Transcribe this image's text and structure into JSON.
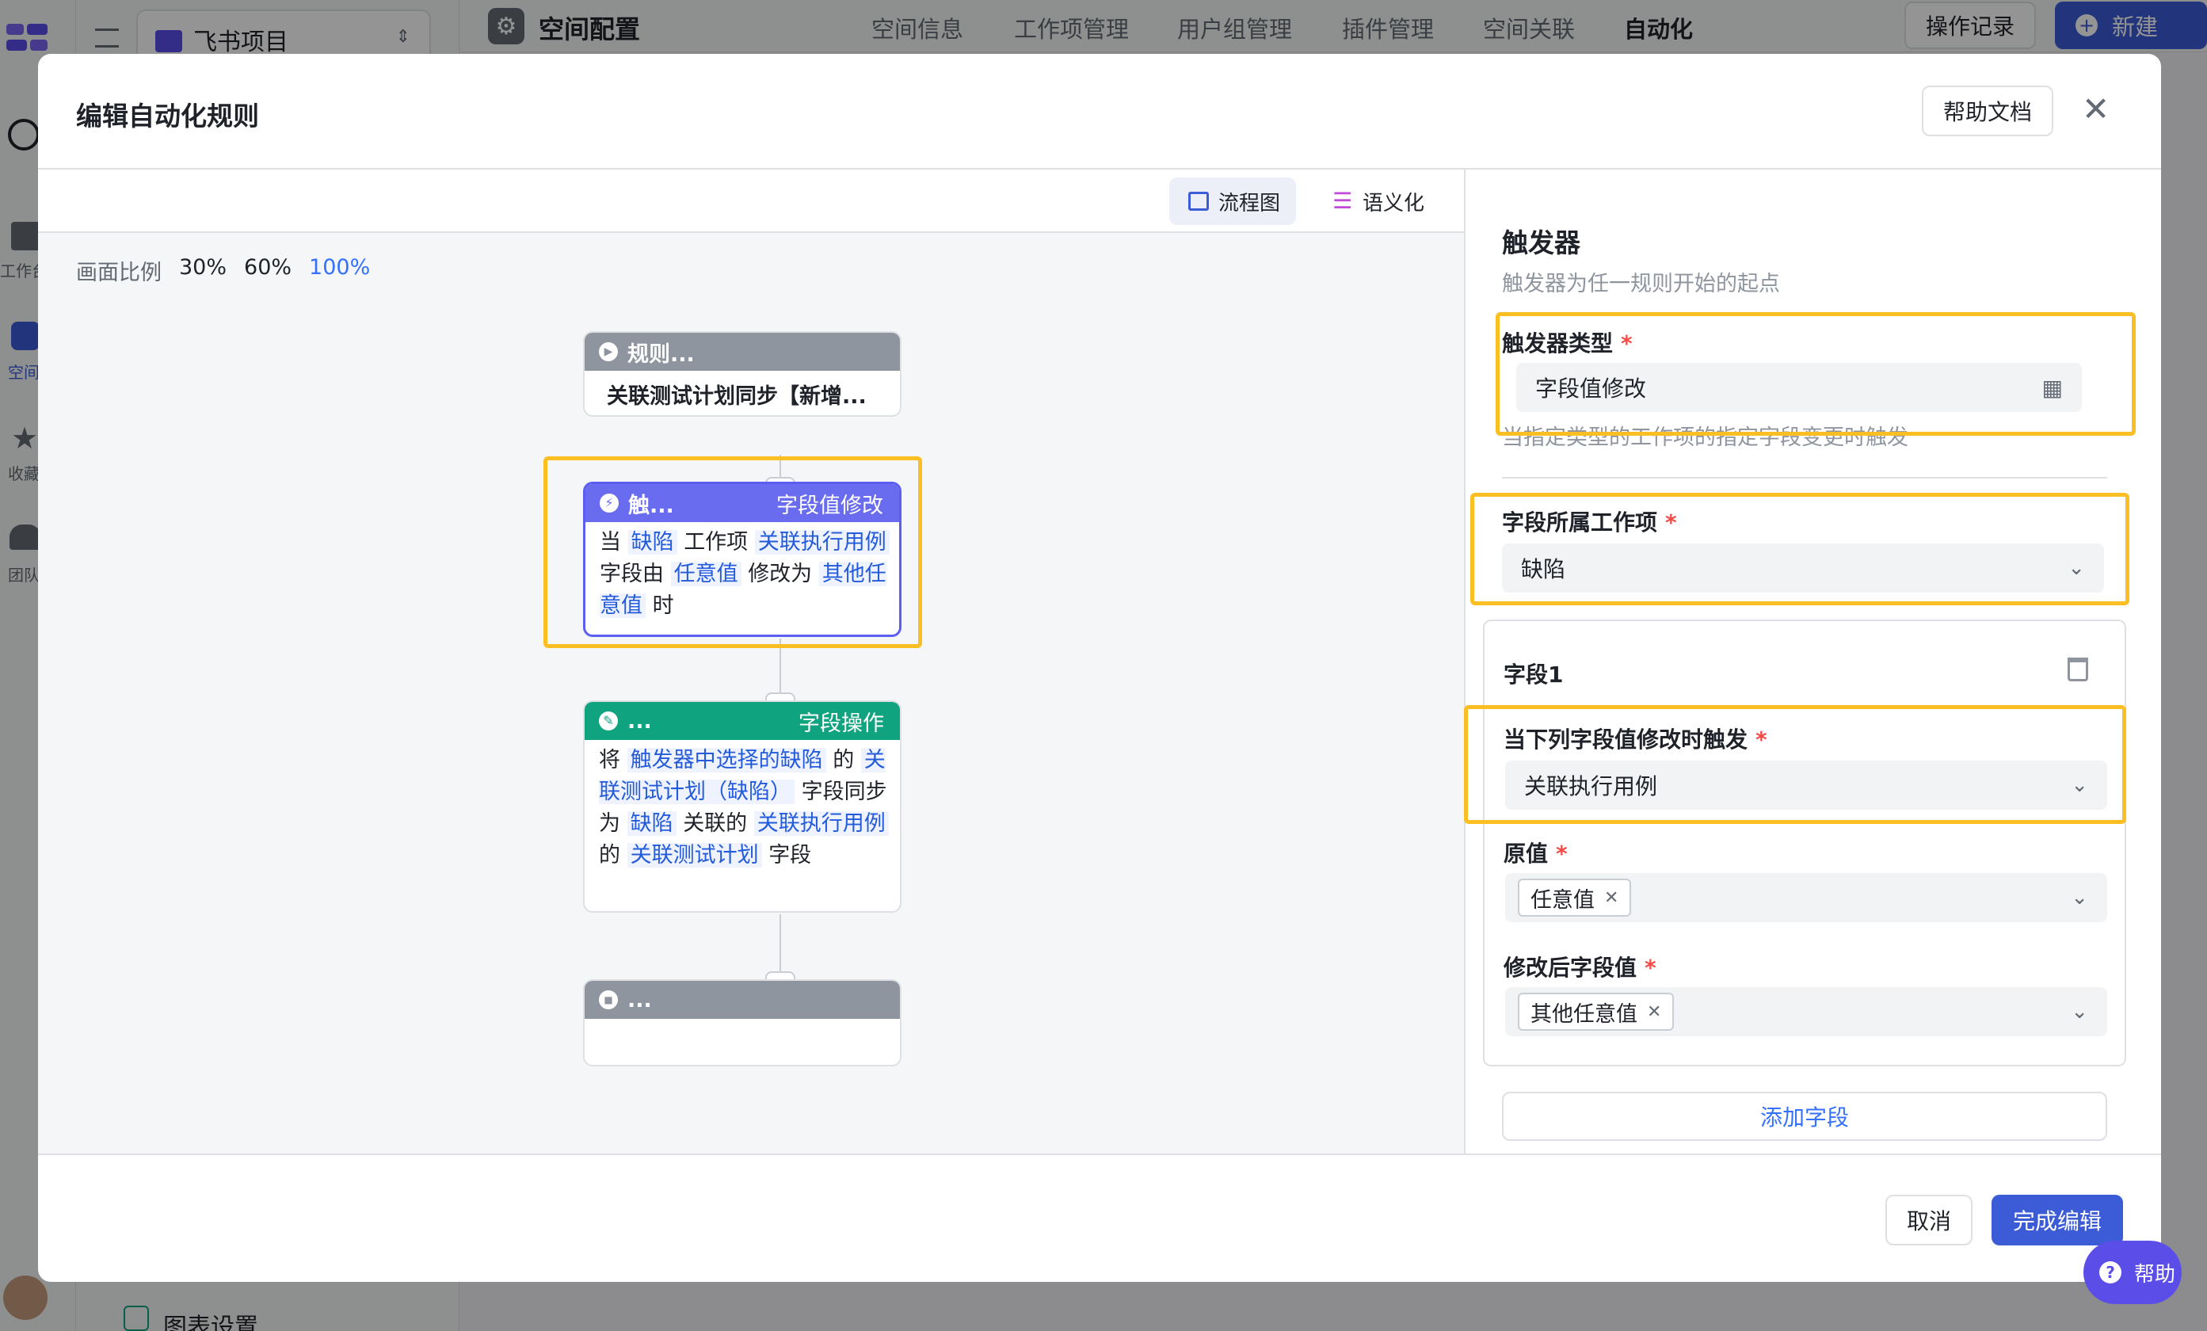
{
  "background": {
    "project_name": "飞书项目",
    "space_config_title": "空间配置",
    "nav_tabs": [
      "空间信息",
      "工作项管理",
      "用户组管理",
      "插件管理",
      "空间关联",
      "自动化"
    ],
    "op_log_button": "操作记录",
    "new_button": "新建",
    "left_nav": [
      "工作台",
      "空间",
      "收藏",
      "团队"
    ],
    "chart_settings": "图表设置"
  },
  "modal": {
    "title": "编辑自动化规则",
    "help_doc_button": "帮助文档",
    "view_tabs": {
      "flowchart": "流程图",
      "semantic": "语义化"
    },
    "zoom": {
      "label": "画面比例",
      "options": [
        "30%",
        "60%",
        "100%"
      ],
      "selected": "100%"
    },
    "flow": {
      "rule_node": {
        "header": "规则...",
        "body": "关联测试计划同步【新增..."
      },
      "trigger_node": {
        "header": "触...",
        "badge": "字段值修改",
        "t1": "当",
        "h1": "缺陷",
        "t2": "工作项",
        "h2": "关联执行用例",
        "t3": "字段由",
        "h3": "任意值",
        "t4": "修改为",
        "h4": "其他任意值",
        "t5": "时"
      },
      "action_node": {
        "header": "...",
        "badge": "字段操作",
        "t1": "将",
        "h1": "触发器中选择的缺陷",
        "t2": "的",
        "h2": "关联测试计划（缺陷）",
        "t3": "字段同步为",
        "h3": "缺陷",
        "t4": "关联的",
        "h4": "关联执行用例",
        "t5": "的",
        "h5": "关联测试计划",
        "t6": "字段"
      },
      "end_node": {
        "header": "..."
      }
    },
    "panel": {
      "title": "触发器",
      "desc": "触发器为任一规则开始的起点",
      "trigger_type_label": "触发器类型",
      "trigger_type_value": "字段值修改",
      "trigger_type_hint": "当指定类型的工作项的指定字段变更时触发",
      "work_item_label": "字段所属工作项",
      "work_item_value": "缺陷",
      "field_card_title": "字段1",
      "field_trigger_label": "当下列字段值修改时触发",
      "field_trigger_value": "关联执行用例",
      "original_label": "原值",
      "original_chip": "任意值",
      "modified_label": "修改后字段值",
      "modified_chip": "其他任意值",
      "add_field_button": "添加字段"
    },
    "footer": {
      "cancel": "取消",
      "done": "完成编辑"
    }
  },
  "help_float": "帮助",
  "colors": {
    "accent": "#3370ff",
    "trigger_header": "#6a6cf0",
    "action_header": "#10a37f",
    "gray_header": "#8f959e",
    "highlight_box": "#fbbf24"
  }
}
